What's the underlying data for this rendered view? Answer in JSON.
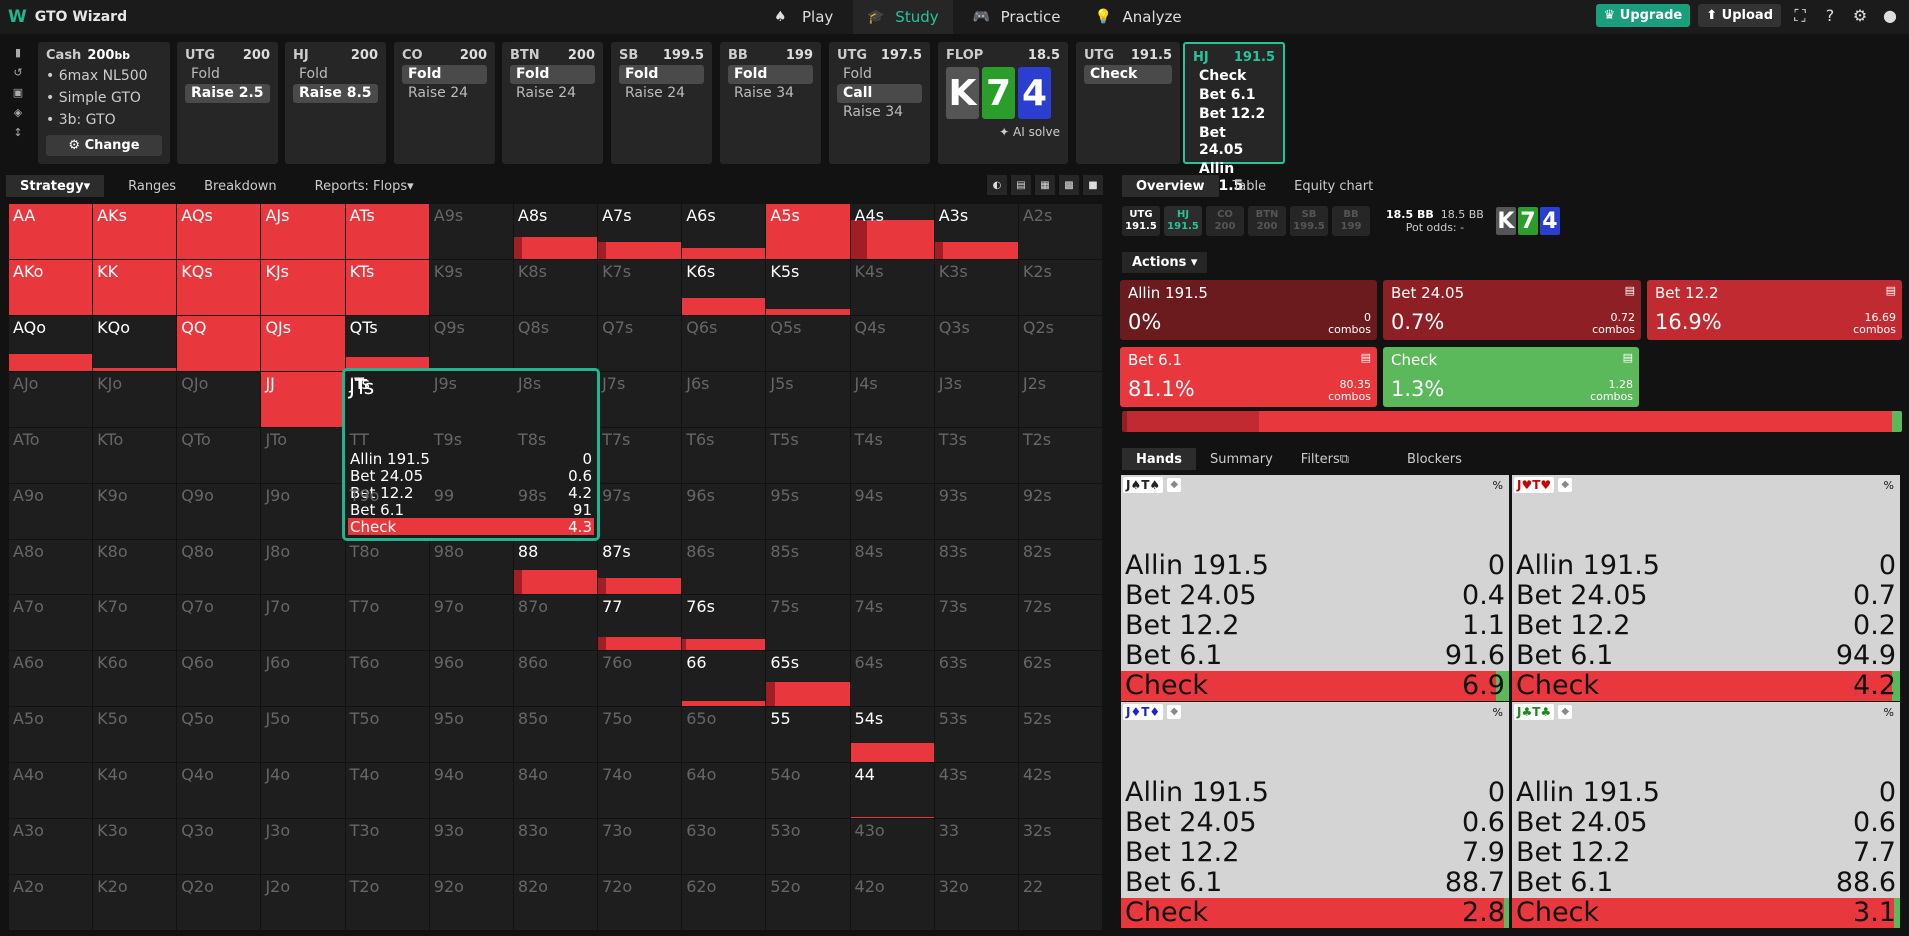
{
  "app": {
    "title": "GTO Wizard"
  },
  "nav": [
    {
      "label": "Play",
      "icon": "cards-icon",
      "active": false
    },
    {
      "label": "Study",
      "icon": "graduation-cap-icon",
      "active": true
    },
    {
      "label": "Practice",
      "icon": "gamepad-icon",
      "active": false
    },
    {
      "label": "Analyze",
      "icon": "lightbulb-icon",
      "active": false
    }
  ],
  "tools": {
    "upgrade": "Upgrade",
    "upload": "Upload"
  },
  "setup": {
    "title": "Cash",
    "stack": "200",
    "stack_unit": "bb",
    "lines": [
      "6max NL500",
      "Simple GTO",
      "3b: GTO"
    ],
    "change": "Change"
  },
  "actions": [
    {
      "pos": "UTG",
      "stack": "200",
      "opts": [
        {
          "t": "Fold",
          "sel": false
        },
        {
          "t": "Raise 2.5",
          "sel": true
        }
      ]
    },
    {
      "pos": "HJ",
      "stack": "200",
      "opts": [
        {
          "t": "Fold",
          "sel": false
        },
        {
          "t": "Raise 8.5",
          "sel": true
        }
      ]
    },
    {
      "pos": "CO",
      "stack": "200",
      "opts": [
        {
          "t": "Fold",
          "sel": true
        },
        {
          "t": "Raise 24",
          "sel": false
        }
      ]
    },
    {
      "pos": "BTN",
      "stack": "200",
      "opts": [
        {
          "t": "Fold",
          "sel": true
        },
        {
          "t": "Raise 24",
          "sel": false
        }
      ]
    },
    {
      "pos": "SB",
      "stack": "199.5",
      "opts": [
        {
          "t": "Fold",
          "sel": true
        },
        {
          "t": "Raise 24",
          "sel": false
        }
      ]
    },
    {
      "pos": "BB",
      "stack": "199",
      "opts": [
        {
          "t": "Fold",
          "sel": true
        },
        {
          "t": "Raise 34",
          "sel": false
        }
      ]
    },
    {
      "pos": "UTG",
      "stack": "197.5",
      "opts": [
        {
          "t": "Fold",
          "sel": false
        },
        {
          "t": "Call",
          "sel": true
        },
        {
          "t": "Raise 34",
          "sel": false
        }
      ]
    }
  ],
  "flop": {
    "label": "FLOP",
    "pot": "18.5",
    "cards": [
      "K",
      "7",
      "4"
    ],
    "ai": "AI solve"
  },
  "after": [
    {
      "pos": "UTG",
      "stack": "191.5",
      "opts": [
        {
          "t": "Check",
          "sel": true
        }
      ]
    },
    {
      "pos": "HJ",
      "stack": "191.5",
      "opts": [
        {
          "t": "Check",
          "sel": false
        },
        {
          "t": "Bet 6.1",
          "sel": false
        },
        {
          "t": "Bet 12.2",
          "sel": false
        },
        {
          "t": "Bet 24.05",
          "sel": false
        },
        {
          "t": "Allin 191.5",
          "sel": false
        }
      ]
    }
  ],
  "left_tabs": [
    "Strategy",
    "Ranges",
    "Breakdown",
    "Reports: Flops"
  ],
  "grid": {
    "rows": [
      [
        "AA",
        "AKs",
        "AQs",
        "AJs",
        "ATs",
        "A9s",
        "A8s",
        "A7s",
        "A6s",
        "A5s",
        "A4s",
        "A3s",
        "A2s"
      ],
      [
        "AKo",
        "KK",
        "KQs",
        "KJs",
        "KTs",
        "K9s",
        "K8s",
        "K7s",
        "K6s",
        "K5s",
        "K4s",
        "K3s",
        "K2s"
      ],
      [
        "AQo",
        "KQo",
        "QQ",
        "QJs",
        "QTs",
        "Q9s",
        "Q8s",
        "Q7s",
        "Q6s",
        "Q5s",
        "Q4s",
        "Q3s",
        "Q2s"
      ],
      [
        "AJo",
        "KJo",
        "QJo",
        "JJ",
        "JTs",
        "J9s",
        "J8s",
        "J7s",
        "J6s",
        "J5s",
        "J4s",
        "J3s",
        "J2s"
      ],
      [
        "ATo",
        "KTo",
        "QTo",
        "JTo",
        "TT",
        "T9s",
        "T8s",
        "T7s",
        "T6s",
        "T5s",
        "T4s",
        "T3s",
        "T2s"
      ],
      [
        "A9o",
        "K9o",
        "Q9o",
        "J9o",
        "T9o",
        "99",
        "98s",
        "97s",
        "96s",
        "95s",
        "94s",
        "93s",
        "92s"
      ],
      [
        "A8o",
        "K8o",
        "Q8o",
        "J8o",
        "T8o",
        "98o",
        "88",
        "87s",
        "86s",
        "85s",
        "84s",
        "83s",
        "82s"
      ],
      [
        "A7o",
        "K7o",
        "Q7o",
        "J7o",
        "T7o",
        "97o",
        "87o",
        "77",
        "76s",
        "75s",
        "74s",
        "73s",
        "72s"
      ],
      [
        "A6o",
        "K6o",
        "Q6o",
        "J6o",
        "T6o",
        "96o",
        "86o",
        "76o",
        "66",
        "65s",
        "64s",
        "63s",
        "62s"
      ],
      [
        "A5o",
        "K5o",
        "Q5o",
        "J5o",
        "T5o",
        "95o",
        "85o",
        "75o",
        "65o",
        "55",
        "54s",
        "53s",
        "52s"
      ],
      [
        "A4o",
        "K4o",
        "Q4o",
        "J4o",
        "T4o",
        "94o",
        "84o",
        "74o",
        "64o",
        "54o",
        "44",
        "43s",
        "42s"
      ],
      [
        "A3o",
        "K3o",
        "Q3o",
        "J3o",
        "T3o",
        "93o",
        "83o",
        "73o",
        "63o",
        "53o",
        "43o",
        "33",
        "32s"
      ],
      [
        "A2o",
        "K2o",
        "Q2o",
        "J2o",
        "T2o",
        "92o",
        "82o",
        "72o",
        "62o",
        "52o",
        "42o",
        "32o",
        "22"
      ]
    ],
    "in_range": [
      "AA",
      "AKs",
      "AQs",
      "AJs",
      "ATs",
      "A8s",
      "A7s",
      "A6s",
      "A5s",
      "A4s",
      "A3s",
      "AKo",
      "KK",
      "KQs",
      "KJs",
      "KTs",
      "K6s",
      "K5s",
      "AQo",
      "KQo",
      "QQ",
      "QJs",
      "QTs",
      "JJ",
      "JTs",
      "88",
      "87s",
      "77",
      "76s",
      "66",
      "65s",
      "55",
      "54s",
      "44"
    ],
    "freq": {
      "AA": [
        1,
        0
      ],
      "AKs": [
        1,
        0
      ],
      "AQs": [
        1,
        0
      ],
      "AJs": [
        1,
        0
      ],
      "ATs": [
        1,
        0
      ],
      "A8s": [
        0.4,
        0.1
      ],
      "A7s": [
        0.3,
        0.1
      ],
      "A6s": [
        0.2,
        0
      ],
      "A5s": [
        1,
        0
      ],
      "A4s": [
        0.7,
        0.2
      ],
      "A3s": [
        0.3,
        0.1
      ],
      "AKo": [
        1,
        0
      ],
      "KK": [
        1,
        0
      ],
      "KQs": [
        1,
        0
      ],
      "KJs": [
        1,
        0
      ],
      "KTs": [
        1,
        0
      ],
      "K6s": [
        0.3,
        0
      ],
      "K5s": [
        0.1,
        0
      ],
      "AQo": [
        0.3,
        0
      ],
      "KQo": [
        0.05,
        0
      ],
      "QQ": [
        1,
        0
      ],
      "QJs": [
        1,
        0
      ],
      "QTs": [
        0.25,
        0
      ],
      "JJ": [
        1,
        0
      ],
      "JTs": [
        0.96,
        0
      ],
      "88": [
        0.45,
        0.1
      ],
      "87s": [
        0.3,
        0.1
      ],
      "77": [
        0.25,
        0.1
      ],
      "76s": [
        0.2,
        0.05
      ],
      "66": [
        0.1,
        0
      ],
      "65s": [
        0.45,
        0.1
      ],
      "55": [
        0,
        0
      ],
      "54s": [
        0.35,
        0
      ],
      "44": [
        0.02,
        0
      ]
    }
  },
  "tooltip": {
    "hand": "JTs",
    "rows": [
      [
        "Allin 191.5",
        "0"
      ],
      [
        "Bet 24.05",
        "0.6"
      ],
      [
        "Bet 12.2",
        "4.2"
      ],
      [
        "Bet 6.1",
        "91"
      ],
      [
        "Check",
        "4.3"
      ]
    ]
  },
  "right_tabs": [
    "Overview",
    "Table",
    "Equity chart"
  ],
  "seats": [
    {
      "pos": "UTG",
      "stack": "191.5",
      "state": "on"
    },
    {
      "pos": "HJ",
      "stack": "191.5",
      "state": "hj"
    },
    {
      "pos": "CO",
      "stack": "200",
      "state": "off"
    },
    {
      "pos": "BTN",
      "stack": "200",
      "state": "off"
    },
    {
      "pos": "SB",
      "stack": "199.5",
      "state": "off"
    },
    {
      "pos": "BB",
      "stack": "199",
      "state": "off"
    }
  ],
  "pot": {
    "main": "18.5 BB",
    "second": "18.5 BB",
    "odds_label": "Pot odds:",
    "odds": "-"
  },
  "actions_label": "Actions",
  "strategy": [
    {
      "name": "Allin 191.5",
      "pct": "0%",
      "combos": "0",
      "color": "#6b1a1e"
    },
    {
      "name": "Bet 24.05",
      "pct": "0.7%",
      "combos": "0.72",
      "color": "#8e1f25"
    },
    {
      "name": "Bet 12.2",
      "pct": "16.9%",
      "combos": "16.69",
      "color": "#c22a31"
    },
    {
      "name": "Bet 6.1",
      "pct": "81.1%",
      "combos": "80.35",
      "color": "#e8373d"
    },
    {
      "name": "Check",
      "pct": "1.3%",
      "combos": "1.28",
      "color": "#5bb85b"
    }
  ],
  "combos_label": "combos",
  "freq_bar": [
    0.007,
    0.169,
    0.811,
    0.013
  ],
  "hand_tabs": [
    "Hands",
    "Summary",
    "Filters",
    "Blockers"
  ],
  "hands": [
    {
      "combo": "J♠T♠",
      "rows": [
        [
          "Allin 191.5",
          "0"
        ],
        [
          "Bet 24.05",
          "0.4"
        ],
        [
          "Bet 12.2",
          "1.1"
        ],
        [
          "Bet 6.1",
          "91.6"
        ],
        [
          "Check",
          "6.9"
        ]
      ],
      "check": 0.069
    },
    {
      "combo": "J♥T♥",
      "rows": [
        [
          "Allin 191.5",
          "0"
        ],
        [
          "Bet 24.05",
          "0.7"
        ],
        [
          "Bet 12.2",
          "0.2"
        ],
        [
          "Bet 6.1",
          "94.9"
        ],
        [
          "Check",
          "4.2"
        ]
      ],
      "check": 0.042
    },
    {
      "combo": "J♦T♦",
      "rows": [
        [
          "Allin 191.5",
          "0"
        ],
        [
          "Bet 24.05",
          "0.6"
        ],
        [
          "Bet 12.2",
          "7.9"
        ],
        [
          "Bet 6.1",
          "88.7"
        ],
        [
          "Check",
          "2.8"
        ]
      ],
      "check": 0.028
    },
    {
      "combo": "J♣T♣",
      "rows": [
        [
          "Allin 191.5",
          "0"
        ],
        [
          "Bet 24.05",
          "0.6"
        ],
        [
          "Bet 12.2",
          "7.7"
        ],
        [
          "Bet 6.1",
          "88.6"
        ],
        [
          "Check",
          "3.1"
        ]
      ],
      "check": 0.031
    }
  ],
  "pct_label": "%"
}
